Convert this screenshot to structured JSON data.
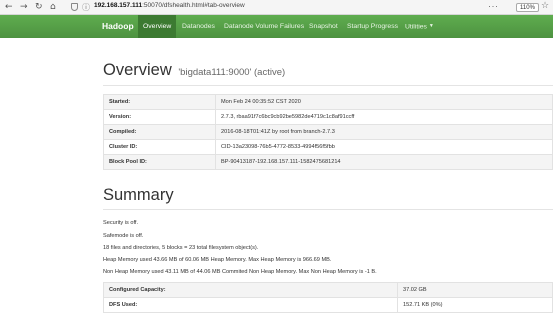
{
  "browser": {
    "back_icon": "back-arrow-icon",
    "forward_icon": "forward-arrow-icon",
    "reload_icon": "reload-icon",
    "home_icon": "home-icon",
    "url_host": "192.168.157.111",
    "url_rest": ":50070/dfshealth.html#tab-overview",
    "menu_glyph": "···",
    "zoom": "110%",
    "bookmark_icon": "star-icon"
  },
  "navbar": {
    "brand": "Hadoop",
    "items": [
      {
        "label": "Overview",
        "active": true
      },
      {
        "label": "Datanodes",
        "active": false
      },
      {
        "label": "Datanode Volume Failures",
        "active": false
      },
      {
        "label": "Snapshot",
        "active": false
      },
      {
        "label": "Startup Progress",
        "active": false
      },
      {
        "label": "Utilities",
        "active": false,
        "dropdown": true
      }
    ],
    "colors": {
      "bar": "#59a14a",
      "active": "#3c7a31"
    }
  },
  "overview": {
    "title": "Overview",
    "subtitle": "'bigdata111:9000' (active)",
    "rows": [
      {
        "key": "Started:",
        "value": "Mon Feb 24 00:35:52 CST 2020"
      },
      {
        "key": "Version:",
        "value": "2.7.3, rbaa91f7c6bc9cb92be5982de4719c1c8af91ccff"
      },
      {
        "key": "Compiled:",
        "value": "2016-08-18T01:41Z by root from branch-2.7.3"
      },
      {
        "key": "Cluster ID:",
        "value": "CID-13a23098-76b5-4772-8533-4994f56f5fbb"
      },
      {
        "key": "Block Pool ID:",
        "value": "BP-90413187-192.168.157.111-1582475681214"
      }
    ]
  },
  "summary": {
    "title": "Summary",
    "lines": [
      "Security is off.",
      "Safemode is off.",
      "18 files and directories, 5 blocks = 23 total filesystem object(s).",
      "Heap Memory used 43.66 MB of 60.06 MB Heap Memory. Max Heap Memory is 966.69 MB.",
      "Non Heap Memory used 43.11 MB of 44.06 MB Commited Non Heap Memory. Max Non Heap Memory is -1 B."
    ],
    "rows": [
      {
        "key": "Configured Capacity:",
        "value": "37.02 GB"
      },
      {
        "key": "DFS Used:",
        "value": "152.71 KB (0%)"
      }
    ]
  }
}
